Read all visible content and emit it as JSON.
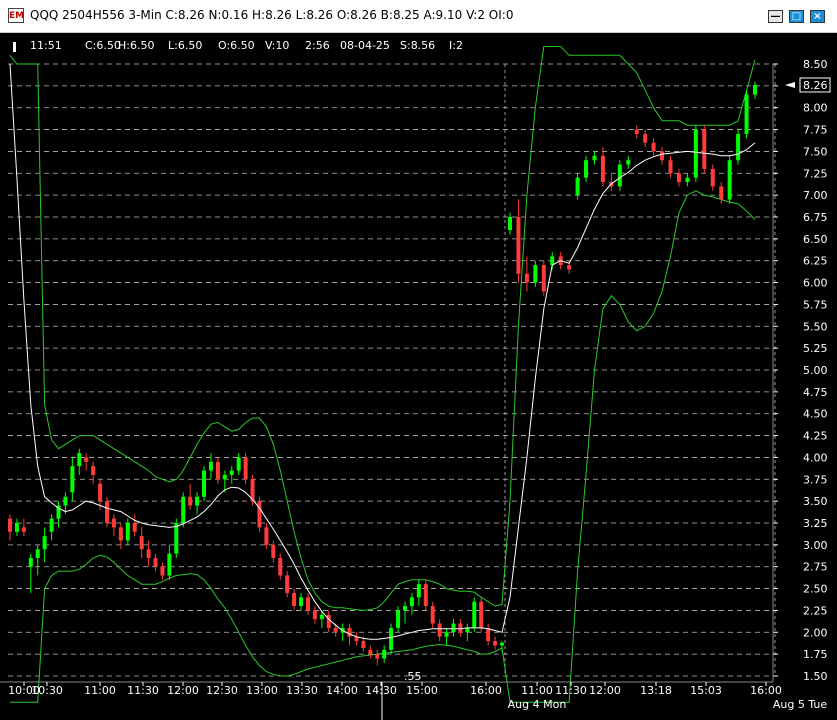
{
  "window": {
    "icon_text": "EM",
    "title": "QQQ 2504H556 3-Min C:8.26 N:0.16 H:8.26 L:8.26 O:8.26 B:8.25 A:9.10 V:2 OI:0",
    "minimize_glyph": "—",
    "maximize_glyph": "□",
    "close_glyph": "×"
  },
  "info_bar": [
    "11:51",
    "C:6.50",
    "H:6.50",
    "L:6.50",
    "O:6.50",
    "V:10",
    "2:56",
    "08-04-25",
    "S:8.56",
    "I:2"
  ],
  "chart_data": {
    "type": "candlestick",
    "title": "QQQ 2504H556 3-Min",
    "ylim": [
      1.5,
      8.5
    ],
    "y_ticks": [
      8.5,
      8.25,
      8.0,
      7.75,
      7.5,
      7.25,
      7.0,
      6.75,
      6.5,
      6.25,
      6.0,
      5.75,
      5.5,
      5.25,
      5.0,
      4.75,
      4.5,
      4.25,
      4.0,
      3.75,
      3.5,
      3.25,
      3.0,
      2.75,
      2.5,
      2.25,
      2.0,
      1.75,
      1.5
    ],
    "y_tick_labels": [
      "8.50",
      "8.25",
      "8.00",
      "7.75",
      "7.50",
      "7.25",
      "7.00",
      "6.75",
      "6.50",
      "6.25",
      "6.00",
      "5.75",
      "5.50",
      "5.25",
      "5.00",
      "4.75",
      "4.50",
      "4.25",
      "4.00",
      "3.75",
      "3.50",
      "3.25",
      "3.00",
      "2.75",
      "2.50",
      "2.25",
      "2.00",
      "1.75",
      "1.50"
    ],
    "x_tick_labels": [
      "10:00",
      "10:30",
      "11:00",
      "11:30",
      "12:00",
      "12:30",
      "13:00",
      "13:30",
      "14:00",
      "14:30",
      "15:00",
      "16:00",
      "11:00",
      "11:30",
      "12:00",
      "13:18",
      "15:03",
      "16:00"
    ],
    "date_labels": [
      "Aug 4 Mon",
      "Aug 5 Tue"
    ],
    "last_price": 8.26,
    "last_price_label": "8.26",
    "low_marker_label": ".55",
    "series": [
      {
        "name": "Price",
        "candles": [
          [
            3.3,
            3.35,
            3.05,
            3.15
          ],
          [
            3.15,
            3.3,
            3.1,
            3.25
          ],
          [
            3.2,
            3.3,
            3.1,
            3.15
          ],
          [
            2.75,
            2.9,
            2.45,
            2.85
          ],
          [
            2.85,
            3.0,
            2.65,
            2.95
          ],
          [
            2.95,
            3.2,
            2.8,
            3.1
          ],
          [
            3.15,
            3.35,
            3.05,
            3.3
          ],
          [
            3.3,
            3.5,
            3.2,
            3.45
          ],
          [
            3.45,
            3.6,
            3.35,
            3.55
          ],
          [
            3.6,
            4.0,
            3.5,
            3.9
          ],
          [
            3.9,
            4.1,
            3.8,
            4.05
          ],
          [
            4.0,
            4.05,
            3.85,
            3.95
          ],
          [
            3.9,
            3.95,
            3.7,
            3.8
          ],
          [
            3.7,
            3.75,
            3.4,
            3.5
          ],
          [
            3.5,
            3.55,
            3.2,
            3.25
          ],
          [
            3.3,
            3.35,
            3.1,
            3.2
          ],
          [
            3.2,
            3.25,
            2.95,
            3.05
          ],
          [
            3.05,
            3.3,
            3.0,
            3.25
          ],
          [
            3.25,
            3.35,
            3.1,
            3.15
          ],
          [
            3.1,
            3.2,
            2.85,
            2.95
          ],
          [
            2.95,
            3.05,
            2.75,
            2.85
          ],
          [
            2.85,
            2.9,
            2.7,
            2.75
          ],
          [
            2.75,
            2.8,
            2.6,
            2.65
          ],
          [
            2.65,
            3.0,
            2.6,
            2.9
          ],
          [
            2.9,
            3.3,
            2.85,
            3.25
          ],
          [
            3.25,
            3.6,
            3.2,
            3.55
          ],
          [
            3.55,
            3.7,
            3.4,
            3.45
          ],
          [
            3.45,
            3.6,
            3.35,
            3.55
          ],
          [
            3.55,
            3.9,
            3.5,
            3.85
          ],
          [
            3.85,
            4.05,
            3.75,
            3.95
          ],
          [
            3.95,
            4.0,
            3.7,
            3.75
          ],
          [
            3.75,
            3.85,
            3.6,
            3.8
          ],
          [
            3.8,
            3.9,
            3.7,
            3.85
          ],
          [
            3.85,
            4.05,
            3.8,
            4.0
          ],
          [
            4.0,
            4.05,
            3.7,
            3.75
          ],
          [
            3.75,
            3.8,
            3.45,
            3.5
          ],
          [
            3.5,
            3.55,
            3.15,
            3.2
          ],
          [
            3.2,
            3.25,
            2.95,
            3.0
          ],
          [
            3.0,
            3.05,
            2.8,
            2.85
          ],
          [
            2.85,
            2.9,
            2.6,
            2.65
          ],
          [
            2.65,
            2.7,
            2.4,
            2.45
          ],
          [
            2.45,
            2.5,
            2.25,
            2.3
          ],
          [
            2.3,
            2.45,
            2.25,
            2.4
          ],
          [
            2.4,
            2.45,
            2.2,
            2.25
          ],
          [
            2.25,
            2.3,
            2.1,
            2.15
          ],
          [
            2.15,
            2.25,
            2.05,
            2.2
          ],
          [
            2.2,
            2.25,
            2.0,
            2.05
          ],
          [
            2.05,
            2.1,
            1.95,
            2.0
          ],
          [
            2.0,
            2.1,
            1.9,
            2.05
          ],
          [
            2.05,
            2.1,
            1.85,
            1.95
          ],
          [
            1.95,
            2.0,
            1.85,
            1.9
          ],
          [
            1.9,
            1.95,
            1.78,
            1.82
          ],
          [
            1.8,
            1.85,
            1.7,
            1.75
          ],
          [
            1.75,
            1.8,
            1.62,
            1.7
          ],
          [
            1.7,
            1.85,
            1.65,
            1.8
          ],
          [
            1.8,
            2.1,
            1.75,
            2.05
          ],
          [
            2.05,
            2.3,
            2.0,
            2.25
          ],
          [
            2.25,
            2.35,
            2.1,
            2.3
          ],
          [
            2.3,
            2.45,
            2.2,
            2.4
          ],
          [
            2.4,
            2.6,
            2.3,
            2.55
          ],
          [
            2.55,
            2.6,
            2.25,
            2.3
          ],
          [
            2.3,
            2.35,
            2.05,
            2.1
          ],
          [
            2.1,
            2.15,
            1.9,
            1.95
          ],
          [
            1.95,
            2.05,
            1.85,
            2.0
          ],
          [
            2.0,
            2.15,
            1.95,
            2.1
          ],
          [
            2.1,
            2.15,
            1.95,
            2.0
          ],
          [
            2.0,
            2.1,
            1.9,
            2.05
          ],
          [
            2.05,
            2.4,
            2.0,
            2.35
          ],
          [
            2.35,
            2.4,
            2.0,
            2.05
          ],
          [
            2.05,
            2.1,
            1.85,
            1.9
          ],
          [
            1.9,
            1.95,
            1.8,
            1.85
          ],
          [
            1.85,
            1.9,
            1.78,
            1.88
          ],
          [
            6.6,
            6.8,
            6.55,
            6.75
          ],
          [
            6.75,
            6.95,
            6.0,
            6.1
          ],
          [
            6.1,
            6.3,
            5.9,
            6.0
          ],
          [
            6.0,
            6.25,
            5.95,
            6.2
          ],
          [
            6.2,
            6.25,
            5.85,
            5.9
          ],
          [
            6.2,
            6.35,
            6.15,
            6.3
          ],
          [
            6.3,
            6.35,
            6.15,
            6.2
          ],
          [
            6.2,
            6.25,
            6.1,
            6.15
          ],
          [
            7.0,
            7.25,
            6.95,
            7.2
          ],
          [
            7.2,
            7.45,
            7.15,
            7.4
          ],
          [
            7.4,
            7.5,
            7.35,
            7.45
          ],
          [
            7.45,
            7.55,
            7.1,
            7.15
          ],
          [
            7.15,
            7.25,
            7.05,
            7.1
          ],
          [
            7.1,
            7.4,
            7.05,
            7.35
          ],
          [
            7.35,
            7.45,
            7.3,
            7.4
          ],
          [
            7.75,
            7.8,
            7.65,
            7.7
          ],
          [
            7.7,
            7.75,
            7.55,
            7.6
          ],
          [
            7.6,
            7.65,
            7.45,
            7.5
          ],
          [
            7.5,
            7.55,
            7.35,
            7.4
          ],
          [
            7.4,
            7.45,
            7.2,
            7.25
          ],
          [
            7.25,
            7.3,
            7.1,
            7.15
          ],
          [
            7.15,
            7.25,
            7.1,
            7.2
          ],
          [
            7.2,
            7.8,
            7.15,
            7.75
          ],
          [
            7.75,
            7.8,
            7.25,
            7.3
          ],
          [
            7.3,
            7.35,
            7.05,
            7.1
          ],
          [
            7.1,
            7.15,
            6.9,
            6.95
          ],
          [
            6.95,
            7.45,
            6.9,
            7.4
          ],
          [
            7.4,
            7.75,
            7.35,
            7.7
          ],
          [
            7.7,
            8.2,
            7.65,
            8.15
          ],
          [
            8.15,
            8.3,
            8.1,
            8.26
          ]
        ]
      },
      {
        "name": "Moving Average",
        "values": [
          8.5,
          7.2,
          5.8,
          4.6,
          3.9,
          3.55,
          3.48,
          3.42,
          3.38,
          3.4,
          3.45,
          3.5,
          3.48,
          3.45,
          3.42,
          3.4,
          3.38,
          3.33,
          3.28,
          3.25,
          3.23,
          3.22,
          3.21,
          3.2,
          3.21,
          3.24,
          3.28,
          3.32,
          3.38,
          3.46,
          3.56,
          3.63,
          3.66,
          3.65,
          3.6,
          3.52,
          3.42,
          3.3,
          3.18,
          3.05,
          2.92,
          2.78,
          2.62,
          2.48,
          2.35,
          2.24,
          2.15,
          2.08,
          2.02,
          1.98,
          1.95,
          1.93,
          1.92,
          1.92,
          1.93,
          1.94,
          1.96,
          1.98,
          2.0,
          2.02,
          2.03,
          2.04,
          2.04,
          2.04,
          2.04,
          2.04,
          2.05,
          2.05,
          2.05,
          2.04,
          2.02,
          2.0,
          2.4,
          3.2,
          4.0,
          4.9,
          5.7,
          6.2,
          6.25,
          6.22,
          6.4,
          6.62,
          6.84,
          7.02,
          7.13,
          7.2,
          7.26,
          7.34,
          7.4,
          7.44,
          7.47,
          7.48,
          7.49,
          7.5,
          7.49,
          7.48,
          7.47,
          7.45,
          7.45,
          7.47,
          7.52,
          7.6
        ]
      },
      {
        "name": "Upper Band",
        "values": [
          8.6,
          8.5,
          8.5,
          8.5,
          8.5,
          4.6,
          4.2,
          4.1,
          4.15,
          4.2,
          4.25,
          4.25,
          4.25,
          4.2,
          4.15,
          4.1,
          4.05,
          4.0,
          3.95,
          3.9,
          3.85,
          3.78,
          3.75,
          3.72,
          3.75,
          3.85,
          4.0,
          4.15,
          4.28,
          4.38,
          4.4,
          4.35,
          4.3,
          4.32,
          4.4,
          4.45,
          4.45,
          4.35,
          4.15,
          3.85,
          3.5,
          3.15,
          2.85,
          2.6,
          2.45,
          2.35,
          2.3,
          2.28,
          2.28,
          2.27,
          2.26,
          2.25,
          2.26,
          2.28,
          2.35,
          2.45,
          2.55,
          2.58,
          2.6,
          2.6,
          2.6,
          2.58,
          2.55,
          2.5,
          2.48,
          2.47,
          2.47,
          2.46,
          2.4,
          2.35,
          2.3,
          2.32,
          3.5,
          5.5,
          7.0,
          8.0,
          8.7,
          8.7,
          8.7,
          8.6,
          8.6,
          8.6,
          8.6,
          8.6,
          8.6,
          8.6,
          8.5,
          8.4,
          8.2,
          8.0,
          7.85,
          7.85,
          7.85,
          7.8,
          7.8,
          7.8,
          7.8,
          7.8,
          7.8,
          7.85,
          8.2,
          8.55
        ]
      },
      {
        "name": "Lower Band",
        "values": [
          1.2,
          1.2,
          1.2,
          1.2,
          1.2,
          2.5,
          2.65,
          2.7,
          2.7,
          2.7,
          2.72,
          2.78,
          2.85,
          2.88,
          2.86,
          2.8,
          2.72,
          2.65,
          2.6,
          2.55,
          2.55,
          2.55,
          2.58,
          2.62,
          2.65,
          2.66,
          2.67,
          2.66,
          2.6,
          2.5,
          2.38,
          2.28,
          2.15,
          2.0,
          1.85,
          1.72,
          1.62,
          1.55,
          1.52,
          1.5,
          1.5,
          1.52,
          1.55,
          1.58,
          1.6,
          1.62,
          1.64,
          1.66,
          1.68,
          1.7,
          1.72,
          1.73,
          1.74,
          1.75,
          1.76,
          1.77,
          1.78,
          1.79,
          1.8,
          1.82,
          1.84,
          1.85,
          1.86,
          1.85,
          1.84,
          1.82,
          1.8,
          1.78,
          1.75,
          1.75,
          1.78,
          1.82,
          1.2,
          1.2,
          1.2,
          1.2,
          1.2,
          1.2,
          1.2,
          1.2,
          2.7,
          3.8,
          5.0,
          5.7,
          5.85,
          5.75,
          5.55,
          5.45,
          5.5,
          5.65,
          5.9,
          6.3,
          6.8,
          7.0,
          7.05,
          7.0,
          6.98,
          6.95,
          6.92,
          6.9,
          6.82,
          6.72
        ]
      }
    ],
    "bull_color": "#00ff00",
    "bear_color": "#ff3b3b",
    "ma_color": "#ffffff",
    "band_color": "#2bc82b",
    "grid_color": "#bdbdbd"
  }
}
